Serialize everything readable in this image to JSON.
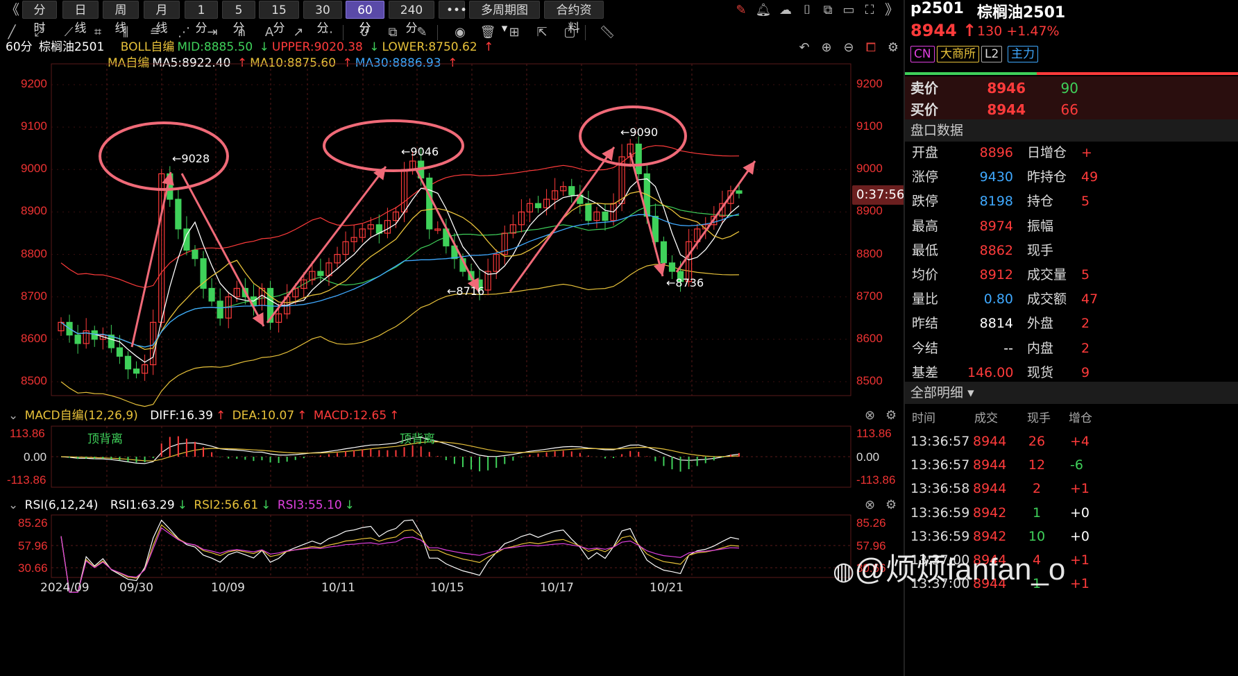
{
  "toolbar": {
    "nav_left": "《",
    "nav_right": "》",
    "periods": [
      "分时",
      "日线",
      "周线",
      "月线",
      "1分",
      "5分",
      "15分",
      "30分",
      "60分",
      "240分"
    ],
    "active_period": "60分",
    "more": "•••",
    "multi_period": "多周期图",
    "contract_info": "合约资料"
  },
  "indicator_boll": {
    "period": "60分",
    "symbol": "棕榈油2501",
    "name": "BOLL自编",
    "mid": "MID:8885.50",
    "upper": "UPPER:9020.38",
    "lower": "LOWER:8750.62"
  },
  "indicator_ma": {
    "name": "MA自编",
    "ma5": "MA5:8922.40",
    "ma10": "MA10:8875.60",
    "ma30": "MA30:8886.93"
  },
  "main_axis": {
    "labels": [
      "9200",
      "9100",
      "9000",
      "8900",
      "8800",
      "8700",
      "8600",
      "8500"
    ]
  },
  "annotations": {
    "high1": "←9028",
    "high2": "←9046",
    "high3": "←9090",
    "low1": "←8716",
    "low2": "←8736"
  },
  "countdown": "0:37:56",
  "macd": {
    "name": "MACD自编(12,26,9)",
    "diff": "DIFF:16.39",
    "dea": "DEA:10.07",
    "macd": "MACD:12.65",
    "axis": [
      "113.86",
      "0.00",
      "-113.86"
    ],
    "note1": "顶背离",
    "note2": "顶背离"
  },
  "rsi": {
    "name": "RSI(6,12,24)",
    "rsi1": "RSI1:63.29",
    "rsi2": "RSI2:56.61",
    "rsi3": "RSI3:55.10",
    "axis": [
      "85.26",
      "57.96",
      "30.66"
    ]
  },
  "dates": [
    "2024/09",
    "09/30",
    "10/09",
    "10/11",
    "10/15",
    "10/17",
    "10/21"
  ],
  "quote": {
    "code": "p2501",
    "name": "棕榈油2501",
    "price": "8944",
    "change": "130",
    "change_pct": "+1.47%",
    "badges": [
      "CN",
      "大商所",
      "L2",
      "主力"
    ],
    "sell_label": "卖价",
    "sell_price": "8946",
    "sell_vol": "90",
    "buy_label": "买价",
    "buy_price": "8944",
    "buy_vol": "66"
  },
  "panel_section": "盘口数据",
  "panel_rows": [
    {
      "l1": "开盘",
      "v1": "8896",
      "l2": "日增仓",
      "v2": "+"
    },
    {
      "l1": "涨停",
      "v1": "9430",
      "l2": "昨持仓",
      "v2": "49"
    },
    {
      "l1": "跌停",
      "v1": "8198",
      "l2": "持仓",
      "v2": "5"
    },
    {
      "l1": "最高",
      "v1": "8974",
      "l2": "振幅",
      "v2": ""
    },
    {
      "l1": "最低",
      "v1": "8862",
      "l2": "现手",
      "v2": ""
    },
    {
      "l1": "均价",
      "v1": "8912",
      "l2": "成交量",
      "v2": "5"
    },
    {
      "l1": "量比",
      "v1": "0.80",
      "l2": "成交额",
      "v2": "47"
    },
    {
      "l1": "昨结",
      "v1": "8814",
      "l2": "外盘",
      "v2": "2"
    },
    {
      "l1": "今结",
      "v1": "--",
      "l2": "内盘",
      "v2": "2"
    },
    {
      "l1": "基差",
      "v1": "146.00",
      "l2": "现货",
      "v2": "9"
    }
  ],
  "detail_section": "全部明细",
  "detail_headers": [
    "时间",
    "成交",
    "现手",
    "增仓"
  ],
  "detail_rows": [
    {
      "t": "13:36:57",
      "p": "8944",
      "v": "26",
      "c": "+4"
    },
    {
      "t": "13:36:57",
      "p": "8944",
      "v": "12",
      "c": "-6"
    },
    {
      "t": "13:36:58",
      "p": "8944",
      "v": "2",
      "c": "+1"
    },
    {
      "t": "13:36:59",
      "p": "8942",
      "v": "1",
      "c": "+0"
    },
    {
      "t": "13:36:59",
      "p": "8942",
      "v": "10",
      "c": "+0"
    },
    {
      "t": "13:37:00",
      "p": "8944",
      "v": "4",
      "c": "+1"
    },
    {
      "t": "13:37:00",
      "p": "8944",
      "v": "1",
      "c": "+1"
    }
  ],
  "watermark": "@烦烦fanfan_o",
  "colors": {
    "up": "#ff3b3b",
    "down": "#3fd15a",
    "accent": "#5a4aa8",
    "ma5": "#ffffff",
    "ma10": "#e8c23a",
    "ma30": "#3fa9ff",
    "boll_upper": "#ff3b3b",
    "boll_mid": "#3fd15a",
    "boll_lower": "#e8c23a"
  }
}
